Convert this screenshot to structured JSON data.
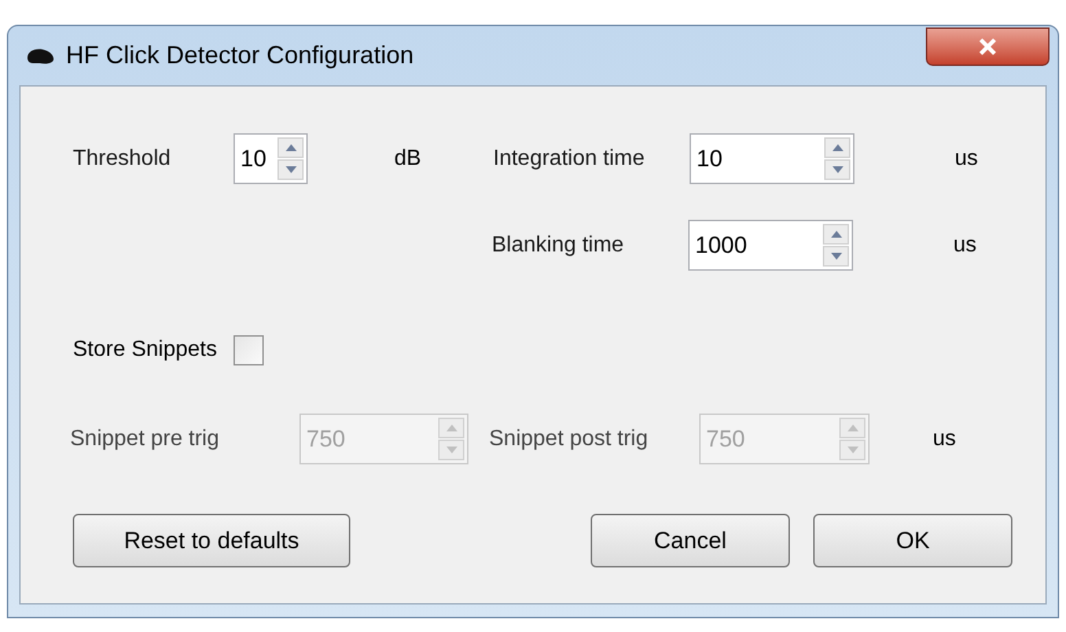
{
  "window": {
    "title": "HF Click Detector Configuration"
  },
  "threshold": {
    "label": "Threshold",
    "value": "10",
    "unit": "dB"
  },
  "integration_time": {
    "label": "Integration time",
    "value": "10",
    "unit": "us"
  },
  "blanking_time": {
    "label": "Blanking time",
    "value": "1000",
    "unit": "us"
  },
  "store_snippets": {
    "label": "Store Snippets",
    "checked": false
  },
  "snippet_pre_trig": {
    "label": "Snippet pre trig",
    "value": "750",
    "disabled": true
  },
  "snippet_post_trig": {
    "label": "Snippet post trig",
    "value": "750",
    "disabled": true,
    "unit": "us"
  },
  "buttons": [
    {
      "label": "Reset to defaults"
    },
    {
      "label": "Cancel"
    },
    {
      "label": "OK"
    }
  ]
}
